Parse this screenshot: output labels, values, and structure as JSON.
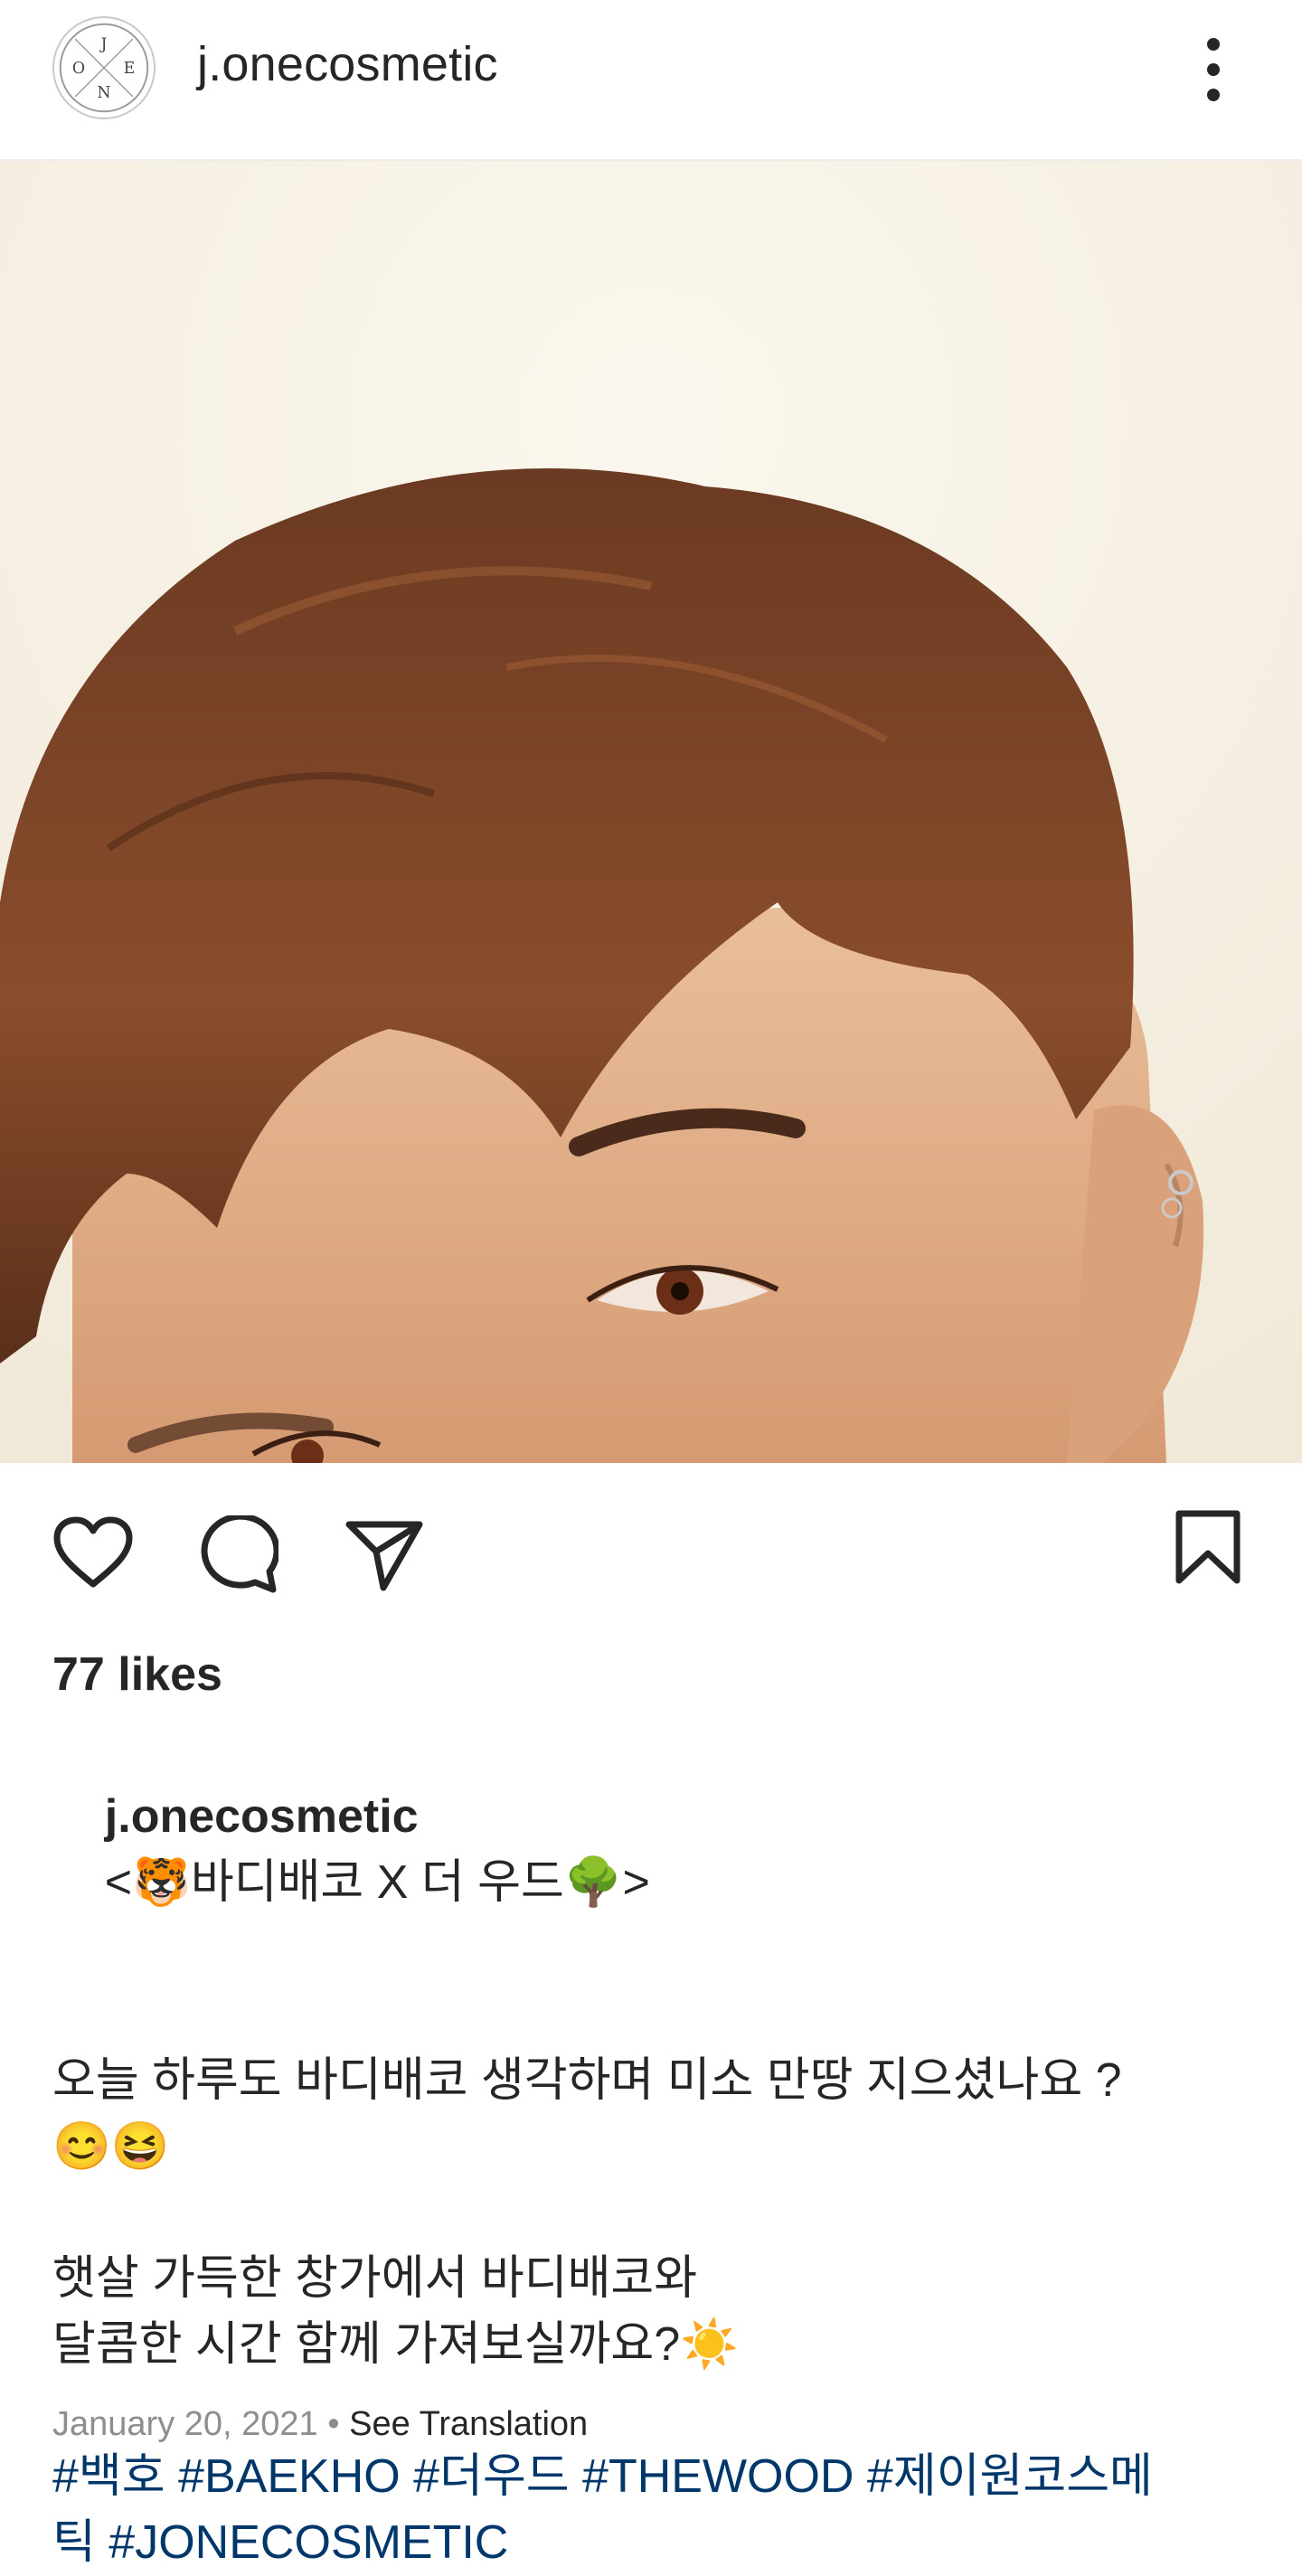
{
  "header": {
    "username": "j.onecosmetic",
    "avatar_letters": [
      "J",
      "O",
      "E",
      "N"
    ]
  },
  "post": {
    "image_alt": "portrait photo of a man with brown hair",
    "likes": "77 likes",
    "caption": {
      "username": "j.onecosmetic",
      "title": "<🐯바디배코 X 더 우드🌳>",
      "line1": "오늘 하루도 바디배코 생각하며 미소 만땅 지으셨나요 ?",
      "line2": "😊😆",
      "line3": "햇살 가득한 창가에서 바디배코와",
      "line4": "달콤한 시간 함께 가져보실까요?☀️",
      "tags_line1": "#백호 #BAEKHO #더우드 #THEWOOD #제이원코스메",
      "tags_line2": "틱 #JONECOSMETIC"
    },
    "date": "January 20, 2021",
    "separator": "•",
    "see_translation": "See Translation"
  },
  "colors": {
    "text": "#262626",
    "hashtag": "#00376b",
    "muted": "#8e8e8e"
  }
}
